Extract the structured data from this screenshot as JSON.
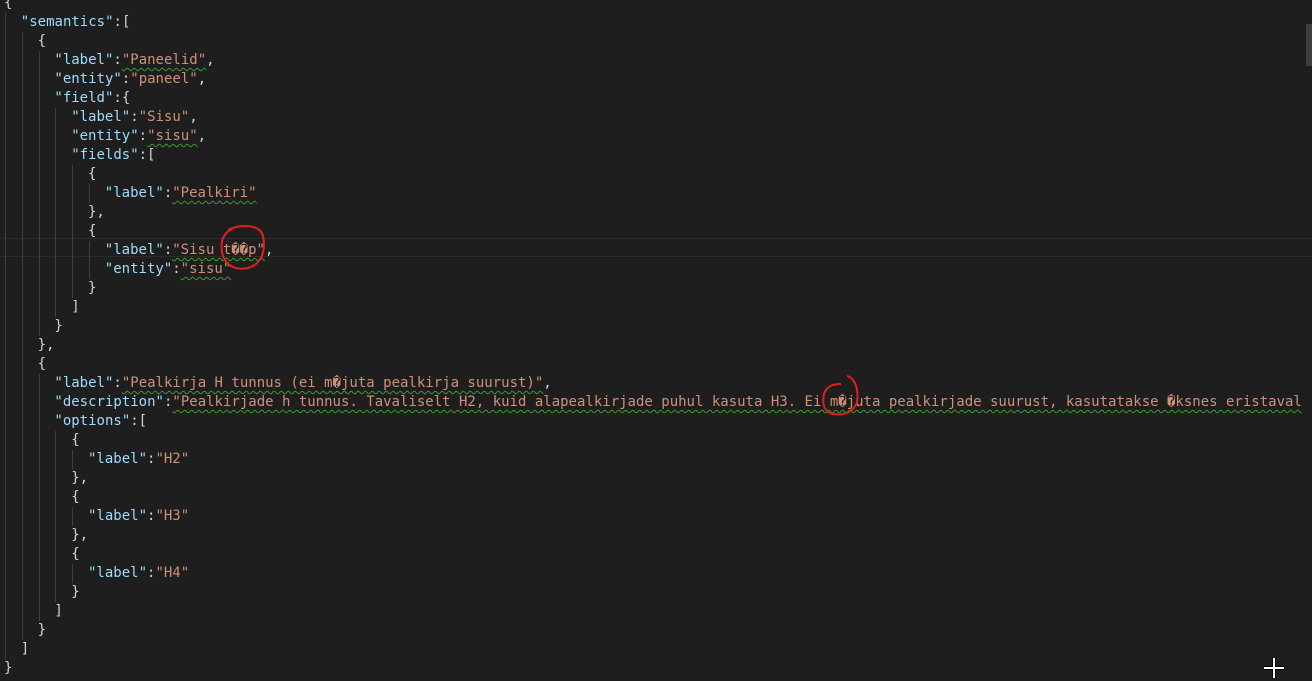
{
  "editor": {
    "language": "json",
    "lines": [
      {
        "n": 1,
        "indent": 0,
        "tokens": [
          {
            "t": "p",
            "v": "{"
          }
        ]
      },
      {
        "n": 2,
        "indent": 1,
        "tokens": [
          {
            "t": "k",
            "v": "\"semantics\""
          },
          {
            "t": "p",
            "v": ":["
          }
        ]
      },
      {
        "n": 3,
        "indent": 2,
        "tokens": [
          {
            "t": "p",
            "v": "{"
          }
        ]
      },
      {
        "n": 4,
        "indent": 3,
        "tokens": [
          {
            "t": "k",
            "v": "\"label\""
          },
          {
            "t": "p",
            "v": ":"
          },
          {
            "t": "s",
            "v": "\"Paneelid\"",
            "sq": true
          },
          {
            "t": "p",
            "v": ","
          }
        ]
      },
      {
        "n": 5,
        "indent": 3,
        "tokens": [
          {
            "t": "k",
            "v": "\"entity\""
          },
          {
            "t": "p",
            "v": ":"
          },
          {
            "t": "s",
            "v": "\"paneel\""
          },
          {
            "t": "p",
            "v": ","
          }
        ]
      },
      {
        "n": 6,
        "indent": 3,
        "tokens": [
          {
            "t": "k",
            "v": "\"field\""
          },
          {
            "t": "p",
            "v": ":{"
          }
        ]
      },
      {
        "n": 7,
        "indent": 4,
        "tokens": [
          {
            "t": "k",
            "v": "\"label\""
          },
          {
            "t": "p",
            "v": ":"
          },
          {
            "t": "s",
            "v": "\"Sisu\""
          },
          {
            "t": "p",
            "v": ","
          }
        ]
      },
      {
        "n": 8,
        "indent": 4,
        "tokens": [
          {
            "t": "k",
            "v": "\"entity\""
          },
          {
            "t": "p",
            "v": ":"
          },
          {
            "t": "s",
            "v": "\"sisu\"",
            "sq": true
          },
          {
            "t": "p",
            "v": ","
          }
        ]
      },
      {
        "n": 9,
        "indent": 4,
        "tokens": [
          {
            "t": "k",
            "v": "\"fields\""
          },
          {
            "t": "p",
            "v": ":["
          }
        ]
      },
      {
        "n": 10,
        "indent": 5,
        "tokens": [
          {
            "t": "p",
            "v": "{"
          }
        ]
      },
      {
        "n": 11,
        "indent": 6,
        "tokens": [
          {
            "t": "k",
            "v": "\"label\""
          },
          {
            "t": "p",
            "v": ":"
          },
          {
            "t": "s",
            "v": "\"Pealkiri\"",
            "sq": true
          }
        ]
      },
      {
        "n": 12,
        "indent": 5,
        "tokens": [
          {
            "t": "p",
            "v": "},"
          }
        ]
      },
      {
        "n": 13,
        "indent": 5,
        "tokens": [
          {
            "t": "p",
            "v": "{"
          }
        ]
      },
      {
        "n": 14,
        "indent": 6,
        "current": true,
        "tokens": [
          {
            "t": "k",
            "v": "\"label\""
          },
          {
            "t": "p",
            "v": ":"
          },
          {
            "t": "s",
            "v": "\"Sisu t��p\"",
            "sq": true
          },
          {
            "t": "p",
            "v": ","
          }
        ]
      },
      {
        "n": 15,
        "indent": 6,
        "tokens": [
          {
            "t": "k",
            "v": "\"entity\""
          },
          {
            "t": "p",
            "v": ":"
          },
          {
            "t": "s",
            "v": "\"sisu\"",
            "sq": true
          }
        ]
      },
      {
        "n": 16,
        "indent": 5,
        "tokens": [
          {
            "t": "p",
            "v": "}"
          }
        ]
      },
      {
        "n": 17,
        "indent": 4,
        "tokens": [
          {
            "t": "p",
            "v": "]"
          }
        ]
      },
      {
        "n": 18,
        "indent": 3,
        "tokens": [
          {
            "t": "p",
            "v": "}"
          }
        ]
      },
      {
        "n": 19,
        "indent": 2,
        "tokens": [
          {
            "t": "p",
            "v": "},"
          }
        ]
      },
      {
        "n": 20,
        "indent": 2,
        "tokens": [
          {
            "t": "p",
            "v": "{"
          }
        ]
      },
      {
        "n": 21,
        "indent": 3,
        "tokens": [
          {
            "t": "k",
            "v": "\"label\""
          },
          {
            "t": "p",
            "v": ":"
          },
          {
            "t": "s",
            "v": "\"Pealkirja H tunnus (ei m�juta pealkirja suurust)\"",
            "sq": true
          },
          {
            "t": "p",
            "v": ","
          }
        ]
      },
      {
        "n": 22,
        "indent": 3,
        "tokens": [
          {
            "t": "k",
            "v": "\"description\""
          },
          {
            "t": "p",
            "v": ":"
          },
          {
            "t": "s",
            "v": "\"Pealkirjade h tunnus. Tavaliselt H2, kuid alapealkirjade puhul kasuta H3. Ei m�juta pealkirjade suurust, kasutatakse �ksnes eristaval",
            "sq": true
          }
        ]
      },
      {
        "n": 23,
        "indent": 3,
        "tokens": [
          {
            "t": "k",
            "v": "\"options\""
          },
          {
            "t": "p",
            "v": ":["
          }
        ]
      },
      {
        "n": 24,
        "indent": 4,
        "tokens": [
          {
            "t": "p",
            "v": "{"
          }
        ]
      },
      {
        "n": 25,
        "indent": 5,
        "tokens": [
          {
            "t": "k",
            "v": "\"label\""
          },
          {
            "t": "p",
            "v": ":"
          },
          {
            "t": "s",
            "v": "\"H2\""
          }
        ]
      },
      {
        "n": 26,
        "indent": 4,
        "tokens": [
          {
            "t": "p",
            "v": "},"
          }
        ]
      },
      {
        "n": 27,
        "indent": 4,
        "tokens": [
          {
            "t": "p",
            "v": "{"
          }
        ]
      },
      {
        "n": 28,
        "indent": 5,
        "tokens": [
          {
            "t": "k",
            "v": "\"label\""
          },
          {
            "t": "p",
            "v": ":"
          },
          {
            "t": "s",
            "v": "\"H3\""
          }
        ]
      },
      {
        "n": 29,
        "indent": 4,
        "tokens": [
          {
            "t": "p",
            "v": "},"
          }
        ]
      },
      {
        "n": 30,
        "indent": 4,
        "tokens": [
          {
            "t": "p",
            "v": "{"
          }
        ]
      },
      {
        "n": 31,
        "indent": 5,
        "tokens": [
          {
            "t": "k",
            "v": "\"label\""
          },
          {
            "t": "p",
            "v": ":"
          },
          {
            "t": "s",
            "v": "\"H4\""
          }
        ]
      },
      {
        "n": 32,
        "indent": 4,
        "tokens": [
          {
            "t": "p",
            "v": "}"
          }
        ]
      },
      {
        "n": 33,
        "indent": 3,
        "tokens": [
          {
            "t": "p",
            "v": "]"
          }
        ]
      },
      {
        "n": 34,
        "indent": 2,
        "tokens": [
          {
            "t": "p",
            "v": "}"
          }
        ]
      },
      {
        "n": 35,
        "indent": 1,
        "tokens": [
          {
            "t": "p",
            "v": "]"
          }
        ]
      },
      {
        "n": 36,
        "indent": 0,
        "tokens": [
          {
            "t": "p",
            "v": "}"
          }
        ]
      }
    ]
  },
  "annotations": [
    {
      "name": "red-circle-annotation-sisu-tyyp",
      "color": "#e0201e"
    },
    {
      "name": "red-circle-annotation-mojuta",
      "color": "#e0201e"
    }
  ],
  "icons": {
    "cursor": "crosshair-cursor-icon"
  },
  "colors": {
    "background": "#1e1e1e",
    "key": "#9cdcfe",
    "string": "#ce9178",
    "punctuation": "#d4d4d4",
    "indent_guide": "#404040",
    "spell_squiggle": "#3d9a2f",
    "annotation": "#e0201e"
  }
}
